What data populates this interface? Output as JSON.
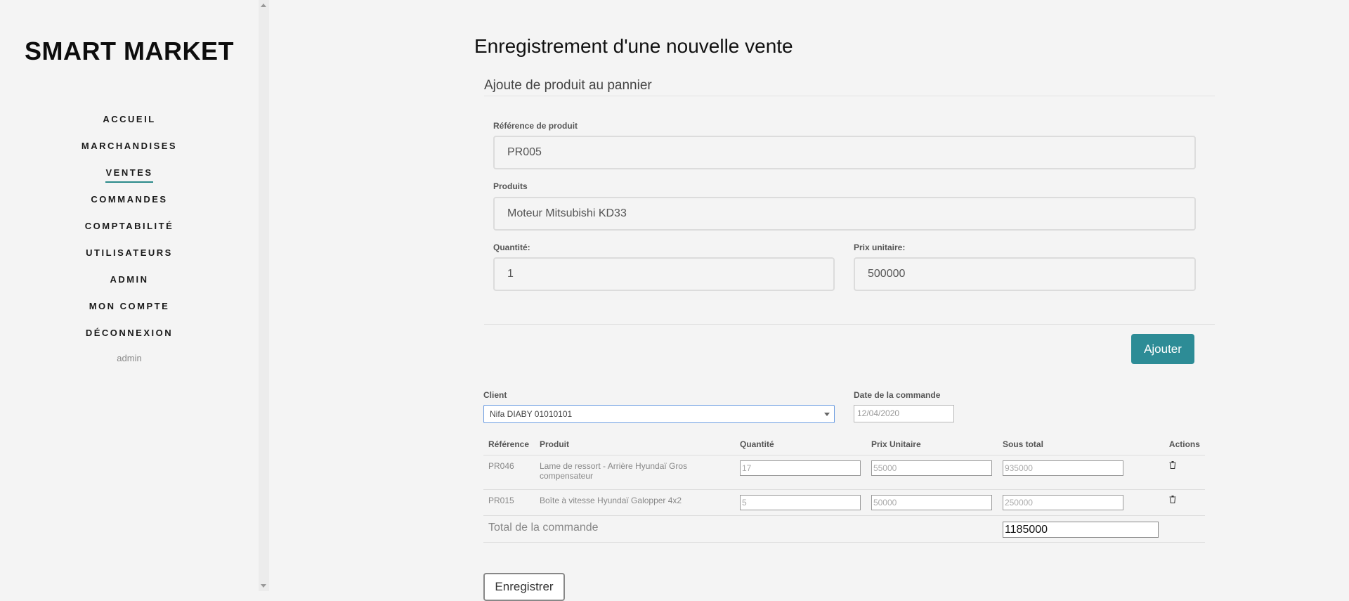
{
  "brand": "SMART MARKET",
  "nav": {
    "items": [
      {
        "label": "ACCUEIL"
      },
      {
        "label": "MARCHANDISES"
      },
      {
        "label": "VENTES"
      },
      {
        "label": "COMMANDES"
      },
      {
        "label": "COMPTABILITÉ"
      },
      {
        "label": "UTILISATEURS"
      },
      {
        "label": "ADMIN"
      },
      {
        "label": "MON COMPTE"
      },
      {
        "label": "DÉCONNEXION"
      }
    ],
    "active": "VENTES",
    "user": "admin"
  },
  "page": {
    "title": "Enregistrement d'une nouvelle vente",
    "section_title": "Ajoute de produit au pannier"
  },
  "form": {
    "reference_label": "Référence de produit",
    "reference_value": "PR005",
    "product_label": "Produits",
    "product_value": "Moteur Mitsubishi KD33",
    "quantity_label": "Quantité:",
    "quantity_value": "1",
    "unit_price_label": "Prix unitaire:",
    "unit_price_value": "500000",
    "add_button": "Ajouter"
  },
  "order": {
    "client_label": "Client",
    "client_value": "Nifa DIABY 01010101",
    "date_label": "Date de la commande",
    "date_value": "12/04/2020"
  },
  "cart": {
    "headers": [
      "Référence",
      "Produit",
      "Quantité",
      "Prix Unitaire",
      "Sous total",
      "Actions"
    ],
    "rows": [
      {
        "reference": "PR046",
        "product": "Lame de ressort - Arrière Hyundaï Gros compensateur",
        "quantity": "17",
        "unit_price": "55000",
        "subtotal": "935000"
      },
      {
        "reference": "PR015",
        "product": "Boîte à vitesse Hyundaï Galopper 4x2",
        "quantity": "5",
        "unit_price": "50000",
        "subtotal": "250000"
      }
    ],
    "total_label": "Total de la commande",
    "total_value": "1185000"
  },
  "save_button": "Enregistrer",
  "colors": {
    "accent": "#2d8c96",
    "nav_underline": "#2b8a8a",
    "background": "#f4f4f4"
  }
}
